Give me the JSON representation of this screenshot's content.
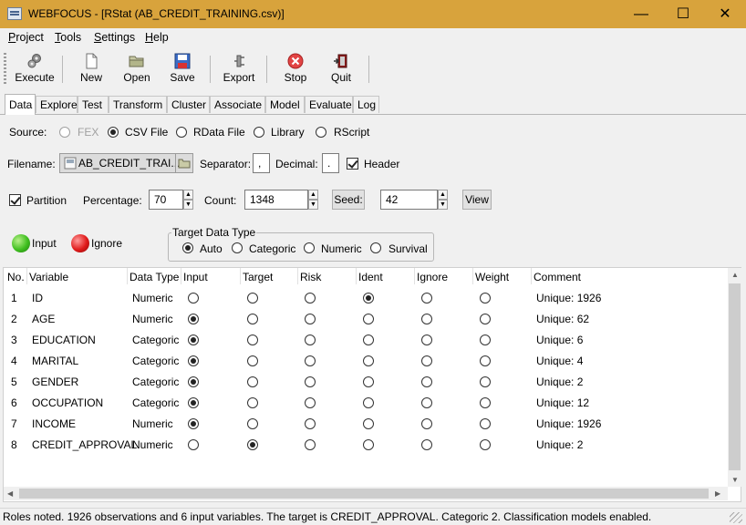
{
  "window": {
    "title": "WEBFOCUS - [RStat (AB_CREDIT_TRAINING.csv)]",
    "minimize": "—",
    "maximize": "☐",
    "close": "✕"
  },
  "menu": [
    "Project",
    "Tools",
    "Settings",
    "Help"
  ],
  "toolbar": [
    {
      "label": "Execute",
      "icon": "gears-icon"
    },
    {
      "label": "New",
      "icon": "new-document-icon"
    },
    {
      "label": "Open",
      "icon": "open-folder-icon"
    },
    {
      "label": "Save",
      "icon": "floppy-disk-icon"
    },
    {
      "label": "Export",
      "icon": "export-plug-icon"
    },
    {
      "label": "Stop",
      "icon": "stop-icon"
    },
    {
      "label": "Quit",
      "icon": "quit-door-icon"
    }
  ],
  "tabs": [
    "Data",
    "Explore",
    "Test",
    "Transform",
    "Cluster",
    "Associate",
    "Model",
    "Evaluate",
    "Log"
  ],
  "source": {
    "label": "Source:",
    "options": [
      "FEX",
      "CSV File",
      "RData File",
      "Library",
      "RScript"
    ],
    "selected": "CSV File"
  },
  "file": {
    "label": "Filename:",
    "value": "AB_CREDIT_TRAI...",
    "separator_label": "Separator:",
    "separator": ",",
    "decimal_label": "Decimal:",
    "decimal": ".",
    "header_label": "Header",
    "header_checked": true
  },
  "partition": {
    "label": "Partition",
    "checked": true,
    "percentage_label": "Percentage:",
    "percentage": "70",
    "count_label": "Count:",
    "count": "1348",
    "seed_button": "Seed:",
    "seed": "42",
    "view_button": "View"
  },
  "legend": {
    "input": "Input",
    "ignore": "Ignore",
    "input_color": "#3fbf1f",
    "ignore_color": "#e01a1a"
  },
  "target_type": {
    "title": "Target Data Type",
    "options": [
      "Auto",
      "Categoric",
      "Numeric",
      "Survival"
    ],
    "selected": "Auto"
  },
  "grid": {
    "columns": [
      "No.",
      "Variable",
      "Data Type",
      "Input",
      "Target",
      "Risk",
      "Ident",
      "Ignore",
      "Weight",
      "Comment"
    ],
    "rows": [
      {
        "no": "1",
        "variable": "ID",
        "type": "Numeric",
        "role": "Ident",
        "comment": "Unique: 1926"
      },
      {
        "no": "2",
        "variable": "AGE",
        "type": "Numeric",
        "role": "Input",
        "comment": "Unique: 62"
      },
      {
        "no": "3",
        "variable": "EDUCATION",
        "type": "Categoric",
        "role": "Input",
        "comment": "Unique: 6"
      },
      {
        "no": "4",
        "variable": "MARITAL",
        "type": "Categoric",
        "role": "Input",
        "comment": "Unique: 4"
      },
      {
        "no": "5",
        "variable": "GENDER",
        "type": "Categoric",
        "role": "Input",
        "comment": "Unique: 2"
      },
      {
        "no": "6",
        "variable": "OCCUPATION",
        "type": "Categoric",
        "role": "Input",
        "comment": "Unique: 12"
      },
      {
        "no": "7",
        "variable": "INCOME",
        "type": "Numeric",
        "role": "Input",
        "comment": "Unique: 1926"
      },
      {
        "no": "8",
        "variable": "CREDIT_APPROVAL",
        "type": "Numeric",
        "role": "Target",
        "comment": "Unique: 2"
      }
    ]
  },
  "status": "Roles noted. 1926 observations and 6 input variables. The target is CREDIT_APPROVAL. Categoric 2. Classification models enabled."
}
